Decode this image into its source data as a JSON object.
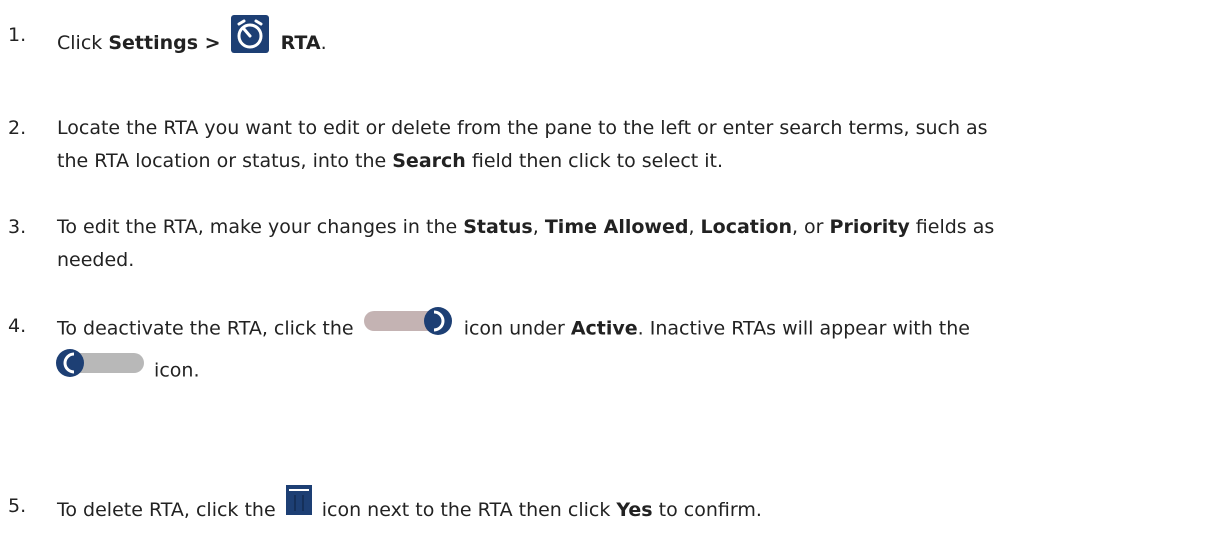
{
  "steps": [
    {
      "number": "1.",
      "parts": [
        "Click",
        "Settings >",
        "RTA",
        "."
      ],
      "icons": [
        "timer-icon"
      ]
    },
    {
      "number": "2.",
      "parts": [
        "Locate the RTA you want to edit or delete from the pane to the left or enter search terms, such as",
        "the RTA location or status, into the",
        "Search",
        "field then click to select it."
      ]
    },
    {
      "number": "3.",
      "parts": [
        "To edit the RTA, make your changes in the",
        "Status",
        ", ",
        "Time Allowed",
        ", ",
        "Location",
        ", or",
        "Priority",
        "fields as",
        "needed."
      ]
    },
    {
      "number": "4.",
      "parts": [
        "To deactivate the RTA, click the",
        "icon under",
        "Active",
        ". Inactive RTAs will appear with the",
        "icon."
      ],
      "icons": [
        "toggle-on-icon",
        "toggle-off-icon"
      ]
    },
    {
      "number": "5.",
      "parts": [
        "To delete RTA, click the",
        "icon next to the RTA then click",
        "Yes",
        "to confirm."
      ],
      "icons": [
        "trash-icon"
      ]
    }
  ],
  "colors": {
    "text": "#222222",
    "icon_navy": "#1d3f74",
    "toggle_track_on": "#c4b3b3",
    "toggle_track_off": "#b8b8b8"
  }
}
